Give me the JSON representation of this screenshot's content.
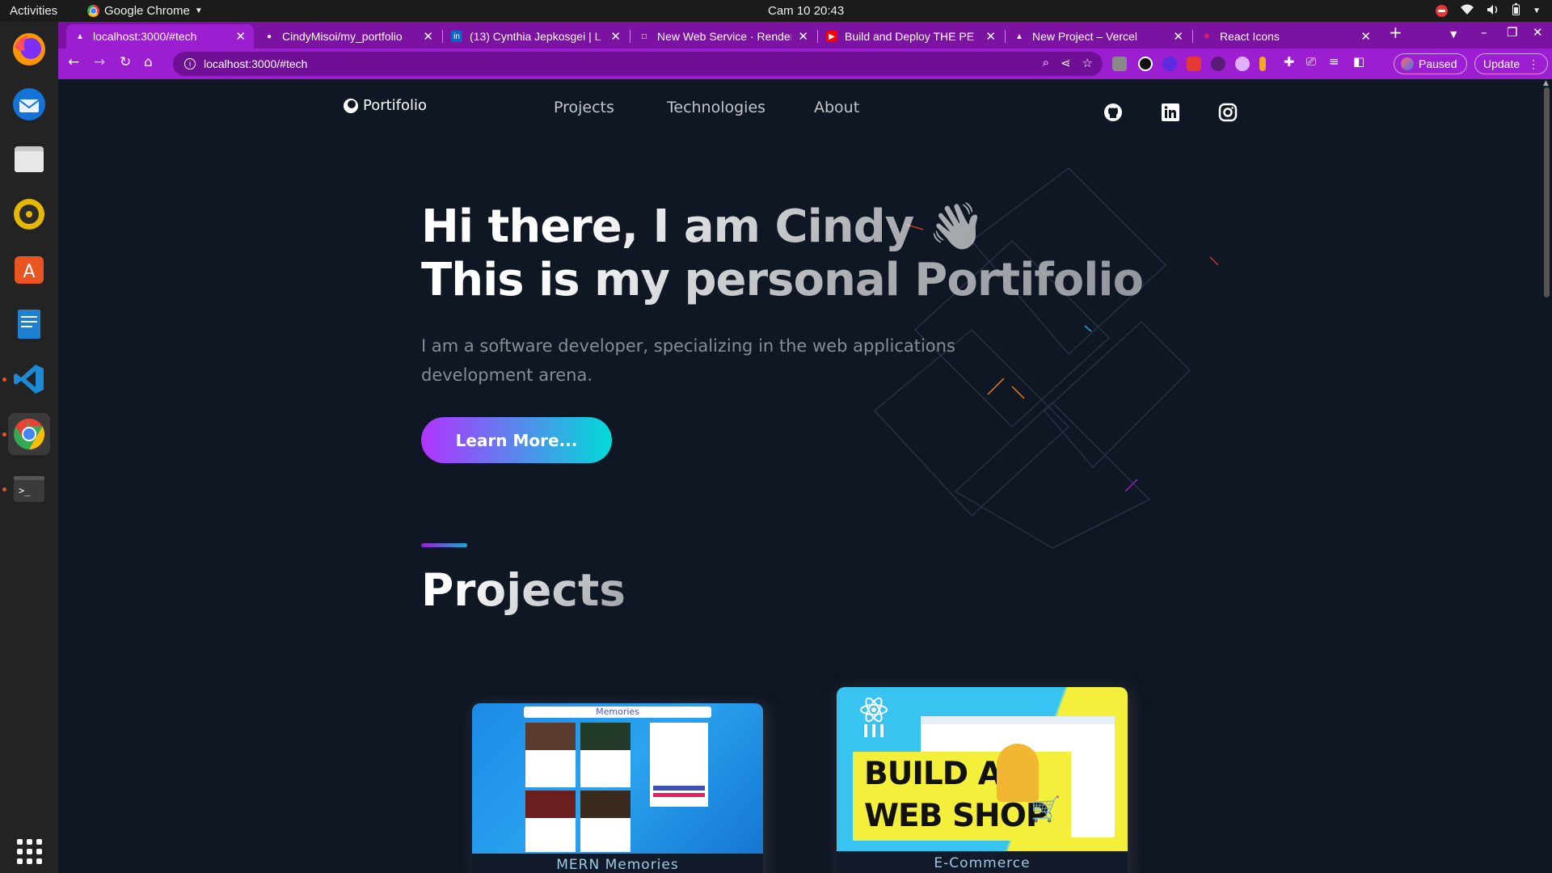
{
  "topbar": {
    "activities": "Activities",
    "app_menu": "Google Chrome",
    "clock": "Cam 10  20:43"
  },
  "dock": {
    "items": [
      "firefox-icon",
      "thunderbird-icon",
      "files-icon",
      "rhythmbox-icon",
      "app-center-icon",
      "writer-icon",
      "vscode-icon",
      "chrome-icon",
      "terminal-icon"
    ]
  },
  "tabs": [
    {
      "title": "localhost:3000/#tech",
      "icon": "▲"
    },
    {
      "title": "CindyMisoi/my_portfolio",
      "icon": "●"
    },
    {
      "title": "(13) Cynthia Jepkosgei | L",
      "icon": "in"
    },
    {
      "title": "New Web Service · Render",
      "icon": "□"
    },
    {
      "title": "Build and Deploy THE PE",
      "icon": "▶"
    },
    {
      "title": "New Project – Vercel",
      "icon": "▲"
    },
    {
      "title": "React Icons",
      "icon": "✺"
    }
  ],
  "toolbar": {
    "url": "localhost:3000/#tech",
    "paused_label": "Paused",
    "update_label": "Update"
  },
  "site": {
    "logo_text": "Portifolio",
    "nav": [
      "Projects",
      "Technologies",
      "About"
    ],
    "hero_line1": "Hi there, I am Cindy 👋",
    "hero_line2": "This is my personal Portifolio",
    "hero_desc": "I am a software developer, specializing in the web applications development arena.",
    "cta_label": "Learn More...",
    "projects_title": "Projects",
    "projects": [
      {
        "title": "MERN Memories",
        "thumb_heading": "Memories"
      },
      {
        "title": "E-Commerce",
        "thumb_line1": "BUILD A",
        "thumb_line2": "WEB SHOP"
      }
    ]
  }
}
